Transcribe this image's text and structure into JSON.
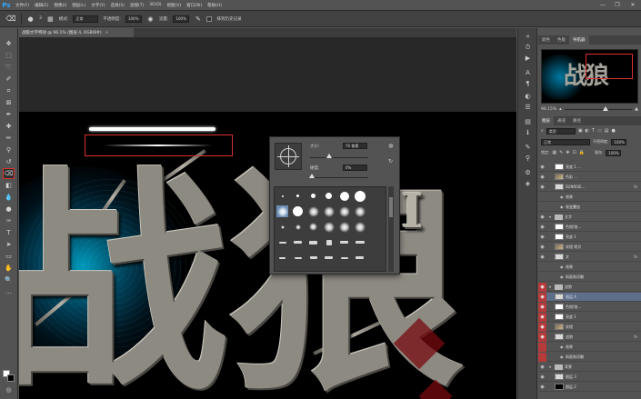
{
  "app": {
    "logo": "Ps"
  },
  "menu": [
    "文件(F)",
    "编辑(E)",
    "图像(I)",
    "图层(L)",
    "文字(Y)",
    "选择(S)",
    "滤镜(T)",
    "3D(D)",
    "视图(V)",
    "窗口(W)",
    "帮助(H)"
  ],
  "window_controls": {
    "minimize": "—",
    "restore": "❐",
    "close": "✕"
  },
  "options": {
    "brush_size": "3",
    "mode_label": "模式:",
    "mode_value": "正常",
    "opacity_label": "不透明度:",
    "opacity_value": "100%",
    "flow_label": "流量:",
    "flow_value": "100%",
    "history_label": "抹到历史记录"
  },
  "document": {
    "tab_title": "战狼文字特效 @ 96.1% (图层 4, RGB/8#)",
    "tab_close": "×",
    "main_text": "战狼",
    "sub_text": "I"
  },
  "brush_picker": {
    "size_label": "大小:",
    "size_value": "70 像素",
    "hardness_label": "硬度:",
    "hardness_value": "0%",
    "sizes_row1": [
      "",
      "",
      "",
      "",
      "",
      ""
    ],
    "sizes_row4": [
      "14",
      "24",
      "27",
      "39",
      "46",
      "59"
    ]
  },
  "right_panel": {
    "tabs_top": [
      "颜色",
      "色板",
      "导航器"
    ],
    "zoom": "96.15%",
    "tabs_layers": [
      "图层",
      "通道",
      "路径"
    ],
    "kind_label": "类型",
    "blend_mode": "正常",
    "opacity_label": "不透明度:",
    "opacity_value": "100%",
    "lock_label": "锁定:",
    "fill_label": "填充:",
    "fill_value": "100%",
    "layers": [
      {
        "name": "亮度 1 ...",
        "thumb": "wht",
        "indent": 1,
        "fx": ""
      },
      {
        "name": "色彩 ...",
        "thumb": "img",
        "indent": 1,
        "fx": ""
      },
      {
        "name": "SUNRISE...",
        "thumb": "chk",
        "indent": 1,
        "fx": "fx"
      },
      {
        "name": "效果",
        "thumb": "",
        "indent": 2,
        "fx": ""
      },
      {
        "name": "渐变叠加",
        "thumb": "",
        "indent": 2,
        "fx": ""
      },
      {
        "name": "文字",
        "thumb": "folder",
        "indent": 0,
        "fx": ""
      },
      {
        "name": "色相/饱...",
        "thumb": "wht",
        "indent": 1,
        "fx": ""
      },
      {
        "name": "亮度 1",
        "thumb": "wht",
        "indent": 1,
        "fx": ""
      },
      {
        "name": "纹理 拷贝",
        "thumb": "img",
        "indent": 1,
        "fx": ""
      },
      {
        "name": "文",
        "thumb": "chk",
        "indent": 1,
        "fx": "fx"
      },
      {
        "name": "效果",
        "thumb": "",
        "indent": 2,
        "fx": ""
      },
      {
        "name": "斜面和浮雕",
        "thumb": "",
        "indent": 2,
        "fx": ""
      },
      {
        "name": "战狼",
        "thumb": "folder",
        "indent": 0,
        "fx": ""
      },
      {
        "name": "图层 4",
        "thumb": "chk",
        "indent": 1,
        "fx": ""
      },
      {
        "name": "色相/饱...",
        "thumb": "wht",
        "indent": 1,
        "fx": ""
      },
      {
        "name": "亮度 1",
        "thumb": "wht",
        "indent": 1,
        "fx": ""
      },
      {
        "name": "纹理",
        "thumb": "img",
        "indent": 1,
        "fx": ""
      },
      {
        "name": "战狼",
        "thumb": "chk",
        "indent": 1,
        "fx": "fx"
      },
      {
        "name": "效果",
        "thumb": "",
        "indent": 2,
        "fx": ""
      },
      {
        "name": "斜面和浮雕",
        "thumb": "",
        "indent": 2,
        "fx": ""
      },
      {
        "name": "背景",
        "thumb": "folder",
        "indent": 0,
        "fx": ""
      },
      {
        "name": "图层 3",
        "thumb": "chk",
        "indent": 1,
        "fx": ""
      },
      {
        "name": "图层 2",
        "thumb": "blk",
        "indent": 1,
        "fx": ""
      }
    ]
  },
  "colors": {
    "foreground": "#ffffff",
    "background": "#000000",
    "highlight": "#d9322d",
    "selected_layer": "#5d6f8a",
    "glow": "#00b4dc"
  }
}
